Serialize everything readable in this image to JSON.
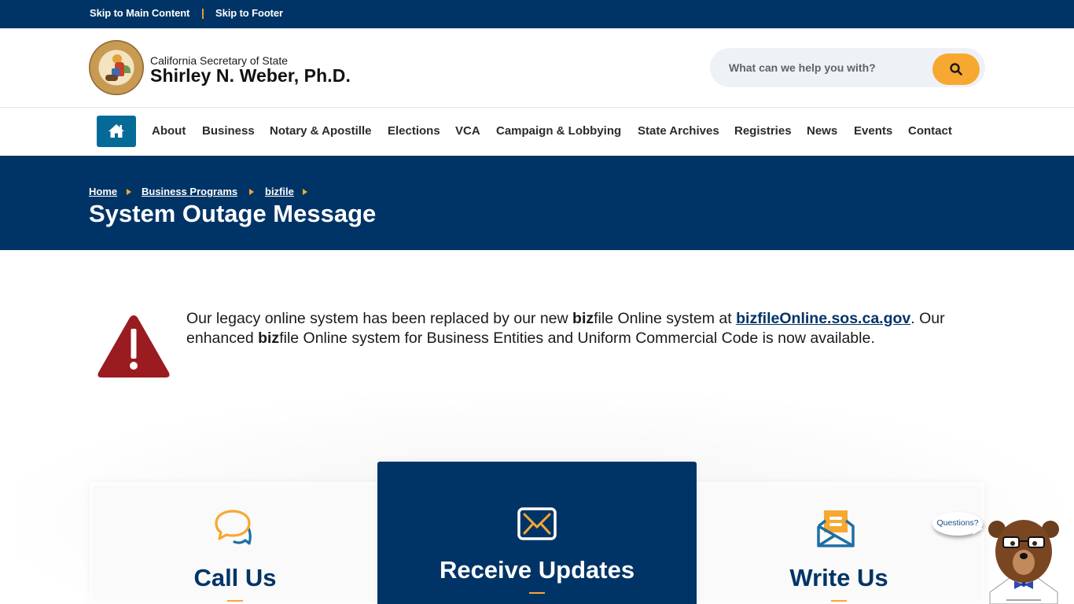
{
  "skip_links": {
    "main": "Skip to Main Content",
    "separator": "|",
    "footer": "Skip to Footer"
  },
  "header": {
    "subtitle": "California Secretary of State",
    "name": "Shirley N. Weber, Ph.D.",
    "search": {
      "placeholder": "What can we help you with?",
      "value": ""
    }
  },
  "nav": {
    "items": [
      {
        "label": "About"
      },
      {
        "label": "Business"
      },
      {
        "label": "Notary & Apostille"
      },
      {
        "label": "Elections"
      },
      {
        "label": "VCA"
      },
      {
        "label": "Campaign & Lobbying"
      },
      {
        "label": "State Archives"
      },
      {
        "label": "Registries"
      },
      {
        "label": "News"
      },
      {
        "label": "Events"
      },
      {
        "label": "Contact"
      }
    ]
  },
  "breadcrumb": [
    {
      "label": "Home"
    },
    {
      "label": "Business Programs"
    },
    {
      "label": "bizfile"
    }
  ],
  "page_title": "System Outage Message",
  "alert": {
    "p1": "Our legacy online system has been replaced by our new ",
    "b1": "biz",
    "p2": "file Online system at ",
    "link": "bizfileOnline.sos.ca.gov",
    "p3": ". Our enhanced ",
    "b2": "biz",
    "p4": "file Online system for Business Entities and Uniform Commercial Code is now available."
  },
  "cards": [
    {
      "title": "Call Us",
      "icon": "chat-bubbles-icon"
    },
    {
      "title": "Receive Updates",
      "icon": "envelope-icon"
    },
    {
      "title": "Write Us",
      "icon": "open-letter-icon"
    }
  ],
  "chatbot": {
    "bubble": "Questions?"
  },
  "colors": {
    "navy": "#003466",
    "gold": "#f7a830",
    "home_blue": "#046b99",
    "alert_red": "#9a1b20"
  }
}
